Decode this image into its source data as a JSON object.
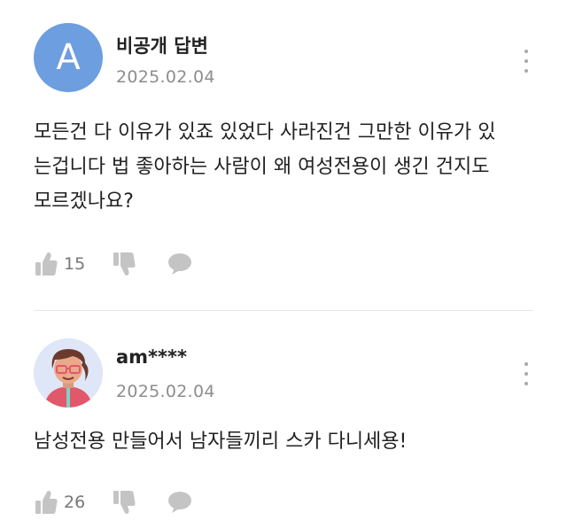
{
  "comments": [
    {
      "avatar_letter": "A",
      "author": "비공개 답변",
      "date": "2025.02.04",
      "body": "모든건 다 이유가 있죠 있었다 사라진건 그만한 이유가 있\n는겁니다 법 좋아하는 사람이 왜 여성전용이 생긴 건지도\n모르겠나요?",
      "likes": "15"
    },
    {
      "avatar_letter": "",
      "author": "am****",
      "date": "2025.02.04",
      "body": "남성전용 만들어서 남자들끼리 스카 다니세용!",
      "likes": "26"
    }
  ],
  "icons": {
    "like": "thumbs-up-icon",
    "dislike": "thumbs-down-icon",
    "reply": "speech-bubble-icon",
    "more": "more-vertical-icon"
  },
  "colors": {
    "avatar_letter_bg": "#6c9ee0",
    "icon_gray": "#c4c4c4",
    "date_gray": "#8d8d8d"
  }
}
